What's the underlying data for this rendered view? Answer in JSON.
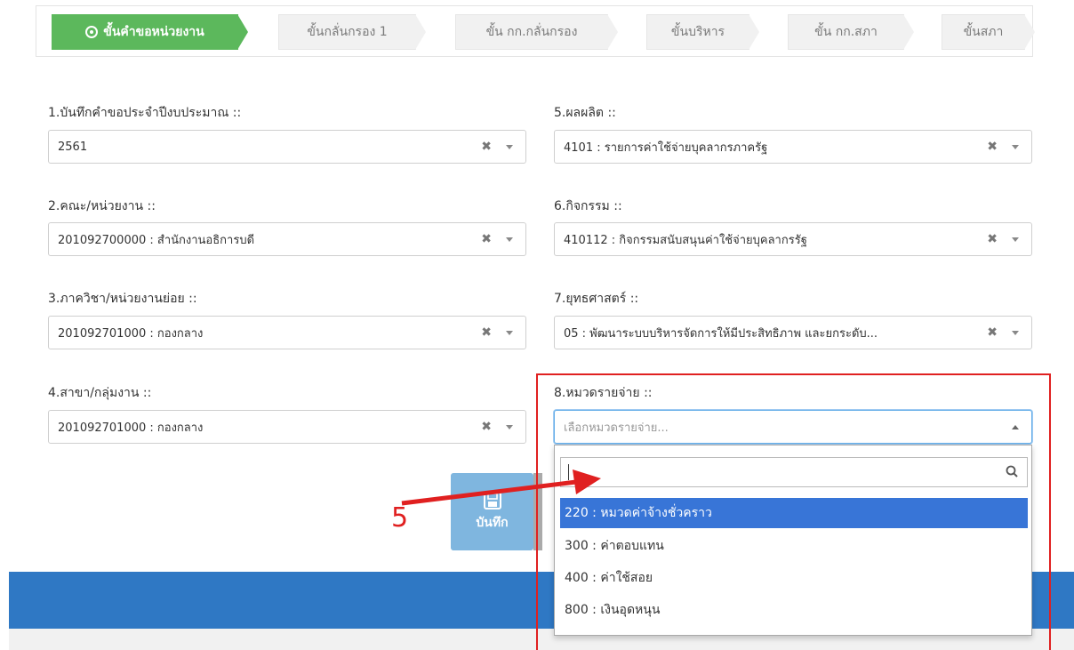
{
  "stepper": {
    "steps": [
      {
        "label": "ขั้นคำขอหน่วยงาน"
      },
      {
        "label": "ขั้นกลั่นกรอง 1"
      },
      {
        "label": "ขั้น กก.กลั่นกรอง"
      },
      {
        "label": "ขั้นบริหาร"
      },
      {
        "label": "ขั้น กก.สภา"
      },
      {
        "label": "ขั้นสภา"
      }
    ],
    "active_index": 0
  },
  "form": {
    "fields": [
      {
        "label": "1.บันทึกคำขอประจำปีงบประมาณ ::",
        "value": "2561"
      },
      {
        "label": "2.คณะ/หน่วยงาน ::",
        "value": "201092700000 : สำนักงานอธิการบดี"
      },
      {
        "label": "3.ภาควิชา/หน่วยงานย่อย ::",
        "value": "201092701000 : กองกลาง"
      },
      {
        "label": "4.สาขา/กลุ่มงาน ::",
        "value": "201092701000 : กองกลาง"
      },
      {
        "label": "5.ผลผลิต ::",
        "value": "4101 : รายการค่าใช้จ่ายบุคลากรภาครัฐ"
      },
      {
        "label": "6.กิจกรรม ::",
        "value": "410112 : กิจกรรมสนับสนุนค่าใช้จ่ายบุคลากรรัฐ"
      },
      {
        "label": "7.ยุทธศาสตร์ ::",
        "value": "05 : พัฒนาระบบบริหารจัดการให้มีประสิทธิภาพ และยกระดับ..."
      },
      {
        "label": "8.หมวดรายจ่าย ::",
        "placeholder": "เลือกหมวดรายจ่าย..."
      }
    ],
    "clear_symbol": "✖"
  },
  "dropdown": {
    "search_value": "",
    "options": [
      "220 : หมวดค่าจ้างชั่วคราว",
      "300 : ค่าตอบแทน",
      "400 : ค่าใช้สอย",
      "800 : เงินอุดหนุน"
    ],
    "highlighted_index": 0
  },
  "save_button": {
    "label": "บันทึก"
  },
  "annotation": {
    "number": "5",
    "color": "#e02020"
  },
  "colors": {
    "active_step": "#5cb85c",
    "highlight": "#3875d7",
    "band": "#2f78c4",
    "save": "#7fb6df"
  }
}
